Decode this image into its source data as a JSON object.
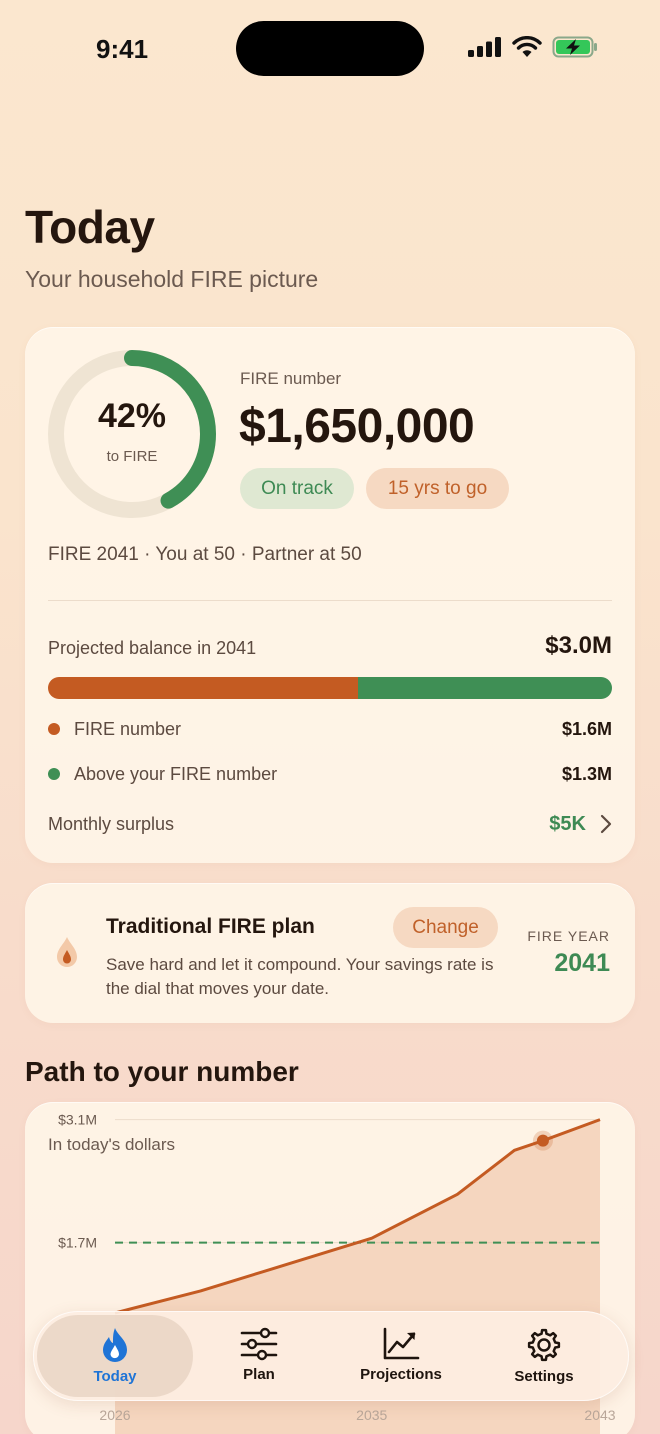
{
  "status_bar": {
    "time": "9:41"
  },
  "header": {
    "title": "Today",
    "subtitle": "Your household FIRE picture"
  },
  "fire_card": {
    "progress_percent": 42,
    "progress_label": "42%",
    "progress_caption": "to FIRE",
    "fire_number_label": "FIRE number",
    "fire_number": "$1,650,000",
    "status_pill": "On track",
    "years_pill": "15 yrs to go",
    "meta": "FIRE 2041 · You at 50 · Partner at 50",
    "projected_label": "Projected balance in 2041",
    "projected_value": "$3.0M",
    "bar_fire_fraction": 0.55,
    "legend": [
      {
        "label": "FIRE number",
        "value": "$1.6M",
        "color": "#c45b22"
      },
      {
        "label": "Above your FIRE number",
        "value": "$1.3M",
        "color": "#3f8f55"
      }
    ],
    "surplus_label": "Monthly surplus",
    "surplus_value": "$5K"
  },
  "plan_card": {
    "title": "Traditional FIRE plan",
    "description": "Save hard and let it compound. Your savings rate is the dial that moves your date.",
    "change_label": "Change",
    "fire_year_label": "FIRE YEAR",
    "fire_year": "2041"
  },
  "chart_section": {
    "title": "Path to your number",
    "subtitle": "In today's dollars"
  },
  "chart_data": {
    "type": "area",
    "title": "",
    "xlabel": "",
    "ylabel": "",
    "y_tick_labels": [
      "$3.1M",
      "$1.7M"
    ],
    "x_tick_labels": [
      "2026",
      "2035",
      "2043"
    ],
    "xlim": [
      2026,
      2043
    ],
    "ylim": [
      0,
      3.3
    ],
    "series": [
      {
        "x": [
          2026,
          2029,
          2032,
          2035,
          2038,
          2040,
          2041,
          2043
        ],
        "y": [
          0.9,
          1.15,
          1.45,
          1.75,
          2.25,
          2.75,
          2.86,
          3.1
        ],
        "color": "#c45b22"
      }
    ],
    "reference_line": {
      "y": 1.7,
      "style": "dashed",
      "color": "#3f8f55"
    },
    "highlight_point": {
      "x": 2041,
      "y": 2.86
    }
  },
  "tabbar": {
    "tabs": [
      {
        "label": "Today",
        "icon": "flame-icon",
        "active": true
      },
      {
        "label": "Plan",
        "icon": "sliders-icon",
        "active": false
      },
      {
        "label": "Projections",
        "icon": "chart-icon",
        "active": false
      },
      {
        "label": "Settings",
        "icon": "gear-icon",
        "active": false
      }
    ]
  }
}
